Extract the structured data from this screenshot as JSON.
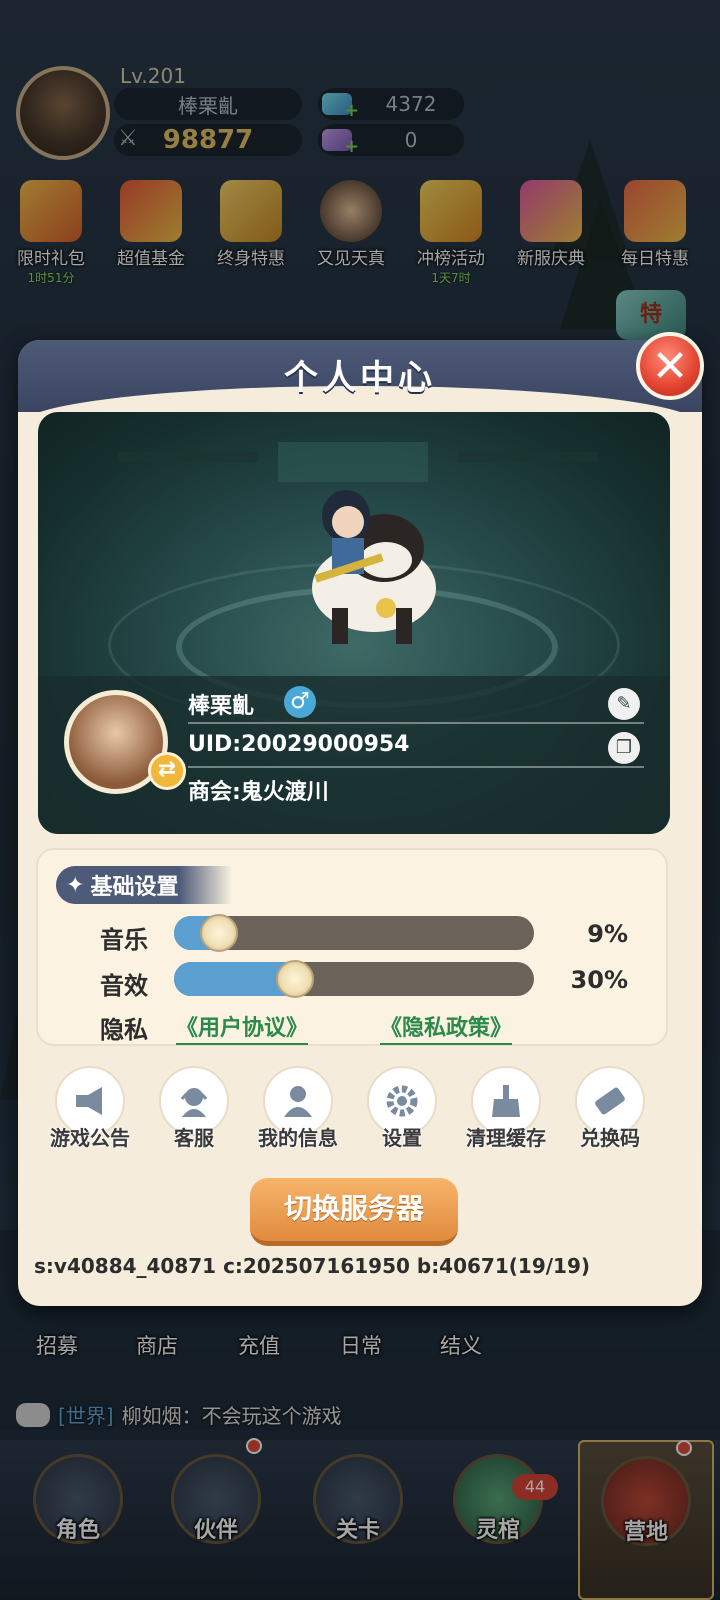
{
  "player": {
    "level": "Lv.201",
    "name": "棒栗齓",
    "power": "98877",
    "diamonds": "4372",
    "tickets": "0"
  },
  "events": [
    {
      "label": "限时礼包",
      "sub": "1时51分",
      "icon": "gift-box-icon"
    },
    {
      "label": "超值基金",
      "sub": "",
      "icon": "fund-chart-icon"
    },
    {
      "label": "终身特惠",
      "sub": "",
      "icon": "treasure-pot-icon"
    },
    {
      "label": "又见天真",
      "sub": "",
      "icon": "character-icon"
    },
    {
      "label": "冲榜活动",
      "sub": "1天7时",
      "icon": "trophy-icon"
    },
    {
      "label": "新服庆典",
      "sub": "",
      "icon": "fireworks-icon"
    },
    {
      "label": "每日特惠",
      "sub": "",
      "icon": "daily-gift-icon"
    }
  ],
  "side_tag": "特",
  "dialog": {
    "title": "个人中心",
    "profile": {
      "name": "棒栗齓",
      "gender_symbol": "♂",
      "uid": "UID:20029000954",
      "guild": "商会:鬼火渡川"
    },
    "settings": {
      "header": "基础设置",
      "music_label": "音乐",
      "music_value": 9,
      "music_pct": "9%",
      "sfx_label": "音效",
      "sfx_value": 30,
      "sfx_pct": "30%",
      "privacy_label": "隐私",
      "user_agreement": "《用户协议》",
      "privacy_policy": "《隐私政策》"
    },
    "functions": [
      {
        "label": "游戏公告",
        "icon": "announcement-icon"
      },
      {
        "label": "客服",
        "icon": "customer-service-icon"
      },
      {
        "label": "我的信息",
        "icon": "user-icon"
      },
      {
        "label": "设置",
        "icon": "gear-icon"
      },
      {
        "label": "清理缓存",
        "icon": "broom-icon"
      },
      {
        "label": "兑换码",
        "icon": "ticket-icon"
      }
    ],
    "switch_server": "切换服务器",
    "version": "s:v40884_40871 c:202507161950 b:40671(19/19)"
  },
  "bottom_shortcuts": [
    {
      "label": "招募",
      "icon": "recruit-icon"
    },
    {
      "label": "商店",
      "icon": "shop-cart-icon"
    },
    {
      "label": "充值",
      "icon": "treasure-chest-icon"
    },
    {
      "label": "日常",
      "icon": "scroll-icon"
    },
    {
      "label": "结义",
      "icon": "heart-chick-icon"
    }
  ],
  "chat": {
    "channel": "[世界]",
    "message": "柳如烟：不会玩这个游戏"
  },
  "nav": [
    {
      "label": "角色",
      "icon": "hero-icon",
      "dot": false
    },
    {
      "label": "伙伴",
      "icon": "partner-icon",
      "dot": true
    },
    {
      "label": "关卡",
      "icon": "sword-icon",
      "dot": false
    },
    {
      "label": "灵棺",
      "icon": "coffin-icon",
      "dot": false,
      "badge": "44"
    },
    {
      "label": "营地",
      "icon": "camp-tent-icon",
      "dot": true,
      "active": true
    }
  ],
  "colors": {
    "accent_orange": "#e08b3e",
    "slider_blue": "#5a9fcf",
    "link_green": "#2a8a4a",
    "header_slate": "#4d5a78",
    "close_red": "#e2432f"
  }
}
